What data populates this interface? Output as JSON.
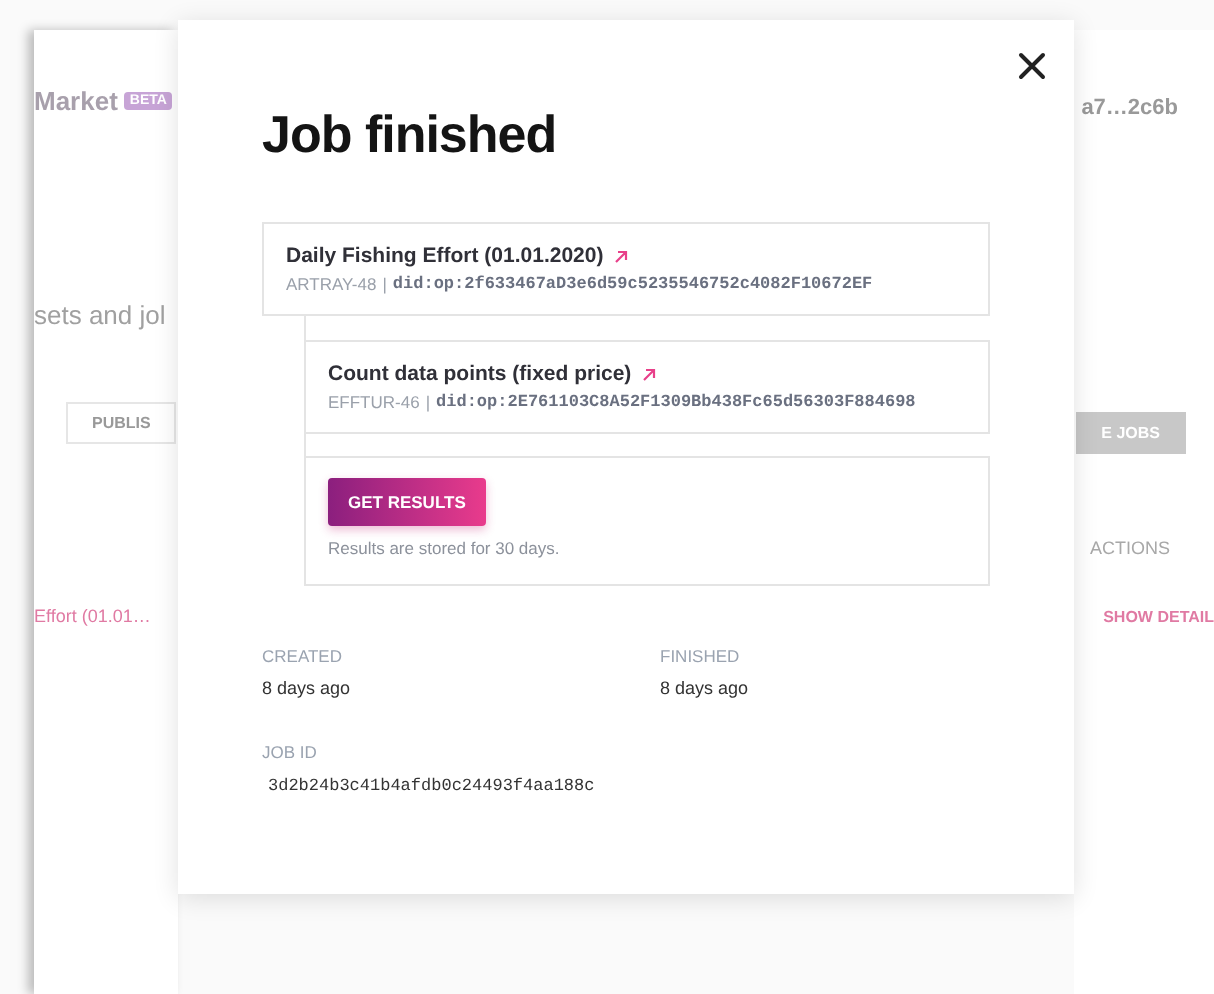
{
  "background": {
    "brand": "Market",
    "badge": "BETA",
    "account": "a7…2c6b",
    "heading": "sets and jol",
    "tabs": [
      {
        "label": "PUBLIS",
        "selected": false
      },
      {
        "label": "E JOBS",
        "selected": true
      }
    ],
    "column_header": "ACTIONS",
    "row": {
      "name": "Effort (01.01…",
      "action": "SHOW DETAIL"
    }
  },
  "modal": {
    "title": "Job finished",
    "steps": [
      {
        "name": "Daily Fishing Effort (01.01.2020)",
        "code": "ARTRAY-48",
        "separator": "|",
        "did": "did:op:2f633467aD3e6d59c5235546752c4082F10672EF"
      },
      {
        "name": "Count data points (fixed price)",
        "code": "EFFTUR-46",
        "separator": "|",
        "did": "did:op:2E761103C8A52F1309Bb438Fc65d56303F884698"
      }
    ],
    "result": {
      "button": "GET RESULTS",
      "note": "Results are stored for 30 days."
    },
    "meta": [
      {
        "label": "CREATED",
        "value": "8 days ago"
      },
      {
        "label": "FINISHED",
        "value": "8 days ago"
      }
    ],
    "job_id": {
      "label": "JOB ID",
      "value": "3d2b24b3c41b4afdb0c24493f4aa188c"
    }
  }
}
